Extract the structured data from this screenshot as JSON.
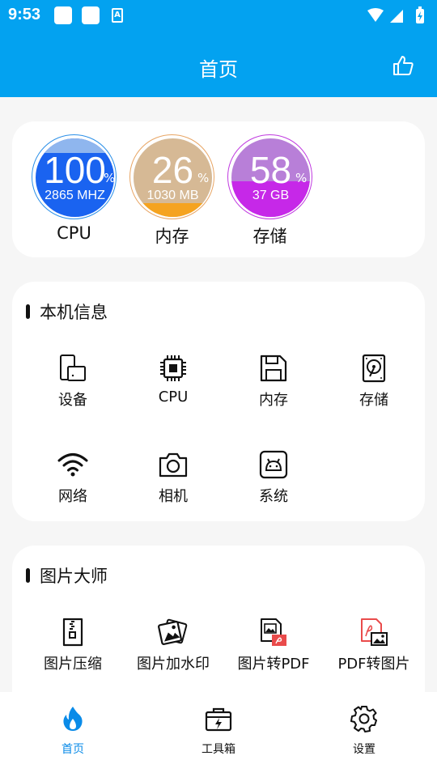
{
  "status_bar": {
    "time": "9:53"
  },
  "app_bar": {
    "title": "首页"
  },
  "resources": [
    {
      "label": "CPU",
      "percent": "100",
      "detail": "2865 MHZ",
      "level": 1.0
    },
    {
      "label": "内存",
      "percent": "26",
      "detail": "1030 MB",
      "level": 0.26
    },
    {
      "label": "存储",
      "percent": "58",
      "detail": "37 GB",
      "level": 0.58
    }
  ],
  "percent_sign": "%",
  "device_info": {
    "title": "本机信息",
    "items": [
      {
        "label": "设备",
        "icon": "device-icon"
      },
      {
        "label": "CPU",
        "icon": "cpu-chip-icon"
      },
      {
        "label": "内存",
        "icon": "memory-save-icon"
      },
      {
        "label": "存储",
        "icon": "hard-disk-icon"
      },
      {
        "label": "网络",
        "icon": "wifi-icon"
      },
      {
        "label": "相机",
        "icon": "camera-icon"
      },
      {
        "label": "系统",
        "icon": "android-icon"
      }
    ]
  },
  "image_master": {
    "title": "图片大师",
    "items": [
      {
        "label": "图片压缩",
        "icon": "zip-file-icon"
      },
      {
        "label": "图片加水印",
        "icon": "watermark-image-icon"
      },
      {
        "label": "图片转PDF",
        "icon": "image-to-pdf-icon"
      },
      {
        "label": "PDF转图片",
        "icon": "pdf-to-image-icon"
      }
    ]
  },
  "bottom_nav": [
    {
      "label": "首页",
      "icon": "flame-icon",
      "active": true
    },
    {
      "label": "工具箱",
      "icon": "toolbox-icon",
      "active": false
    },
    {
      "label": "设置",
      "icon": "gear-icon",
      "active": false
    }
  ],
  "colors": {
    "primary": "#03a2f0",
    "cpu_ring": "#2a8fe8",
    "cpu_fill": "#1a63f0",
    "mem_ring": "#e8a564",
    "mem_fill": "#f5a320",
    "storage_ring": "#c03ae0",
    "storage_fill": "#c628e8",
    "nav_active": "#0a8be8"
  }
}
